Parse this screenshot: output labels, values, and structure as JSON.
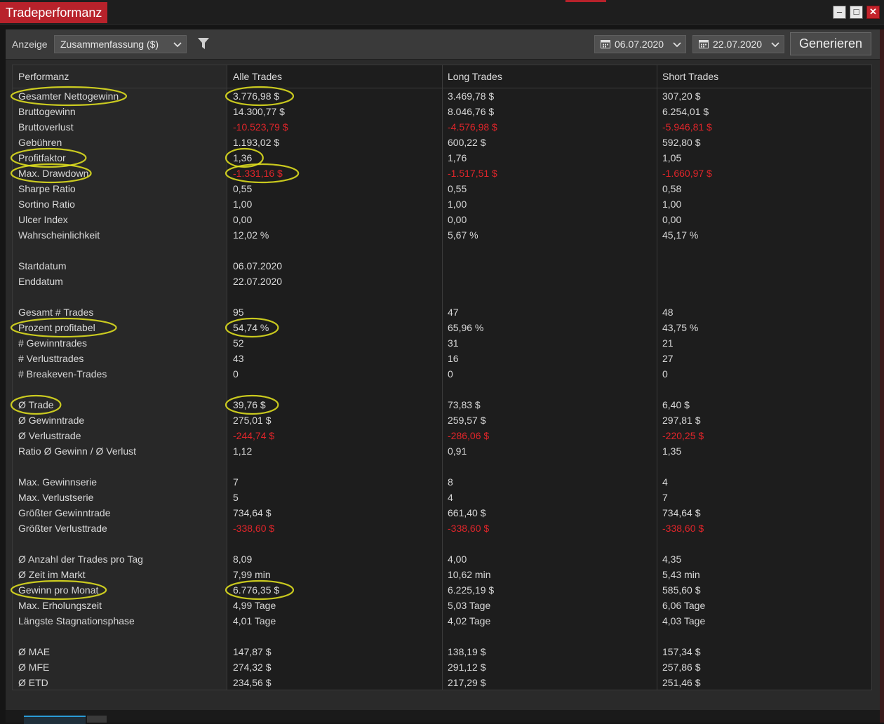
{
  "window": {
    "title": "Tradeperformanz",
    "controls": [
      "minimize-icon",
      "maximize-icon",
      "close-icon"
    ]
  },
  "toolbar": {
    "display_label": "Anzeige",
    "display_value": "Zusammenfassung ($)",
    "date_from": "06.07.2020",
    "date_to": "22.07.2020",
    "generate_label": "Generieren"
  },
  "colors": {
    "accent": "#b8222b",
    "negative": "#e0252a",
    "highlight": "#e6e61e"
  },
  "table": {
    "headers": [
      "Performanz",
      "Alle Trades",
      "Long Trades",
      "Short Trades"
    ],
    "rows": [
      {
        "label": "Gesamter Nettogewinn",
        "all": "3.776,98 $",
        "long": "3.469,78 $",
        "short": "307,20 $",
        "neg": false,
        "hl": true
      },
      {
        "label": "Bruttogewinn",
        "all": "14.300,77 $",
        "long": "8.046,76 $",
        "short": "6.254,01 $",
        "neg": false
      },
      {
        "label": "Bruttoverlust",
        "all": "-10.523,79 $",
        "long": "-4.576,98 $",
        "short": "-5.946,81 $",
        "neg": true
      },
      {
        "label": "Gebühren",
        "all": "1.193,02 $",
        "long": "600,22 $",
        "short": "592,80 $",
        "neg": false
      },
      {
        "label": "Profitfaktor",
        "all": "1,36",
        "long": "1,76",
        "short": "1,05",
        "neg": false,
        "hl": true
      },
      {
        "label": "Max. Drawdown",
        "all": "-1.331,16 $",
        "long": "-1.517,51 $",
        "short": "-1.660,97 $",
        "neg": true,
        "hl": true
      },
      {
        "label": "Sharpe Ratio",
        "all": "0,55",
        "long": "0,55",
        "short": "0,58",
        "neg": false
      },
      {
        "label": "Sortino Ratio",
        "all": "1,00",
        "long": "1,00",
        "short": "1,00",
        "neg": false
      },
      {
        "label": "Ulcer Index",
        "all": "0,00",
        "long": "0,00",
        "short": "0,00",
        "neg": false
      },
      {
        "label": "Wahrscheinlichkeit",
        "all": "12,02 %",
        "long": "5,67 %",
        "short": "45,17 %",
        "neg": false
      },
      {
        "spacer": true
      },
      {
        "label": "Startdatum",
        "all": "06.07.2020",
        "long": "",
        "short": "",
        "neg": false
      },
      {
        "label": "Enddatum",
        "all": "22.07.2020",
        "long": "",
        "short": "",
        "neg": false
      },
      {
        "spacer": true
      },
      {
        "label": "Gesamt # Trades",
        "all": "95",
        "long": "47",
        "short": "48",
        "neg": false
      },
      {
        "label": "Prozent profitabel",
        "all": "54,74 %",
        "long": "65,96 %",
        "short": "43,75 %",
        "neg": false,
        "hl": true
      },
      {
        "label": "# Gewinntrades",
        "all": "52",
        "long": "31",
        "short": "21",
        "neg": false
      },
      {
        "label": "# Verlusttrades",
        "all": "43",
        "long": "16",
        "short": "27",
        "neg": false
      },
      {
        "label": "# Breakeven-Trades",
        "all": "0",
        "long": "0",
        "short": "0",
        "neg": false
      },
      {
        "spacer": true
      },
      {
        "label": "Ø Trade",
        "all": "39,76 $",
        "long": "73,83 $",
        "short": "6,40 $",
        "neg": false,
        "hl": true
      },
      {
        "label": "Ø Gewinntrade",
        "all": "275,01 $",
        "long": "259,57 $",
        "short": "297,81 $",
        "neg": false
      },
      {
        "label": "Ø Verlusttrade",
        "all": "-244,74 $",
        "long": "-286,06 $",
        "short": "-220,25 $",
        "neg": true
      },
      {
        "label": "Ratio Ø Gewinn / Ø Verlust",
        "all": "1,12",
        "long": "0,91",
        "short": "1,35",
        "neg": false
      },
      {
        "spacer": true
      },
      {
        "label": "Max. Gewinnserie",
        "all": "7",
        "long": "8",
        "short": "4",
        "neg": false
      },
      {
        "label": "Max. Verlustserie",
        "all": "5",
        "long": "4",
        "short": "7",
        "neg": false
      },
      {
        "label": "Größter Gewinntrade",
        "all": "734,64 $",
        "long": "661,40 $",
        "short": "734,64 $",
        "neg": false
      },
      {
        "label": "Größter Verlusttrade",
        "all": "-338,60 $",
        "long": "-338,60 $",
        "short": "-338,60 $",
        "neg": true
      },
      {
        "spacer": true
      },
      {
        "label": "Ø Anzahl der Trades pro Tag",
        "all": "8,09",
        "long": "4,00",
        "short": "4,35",
        "neg": false
      },
      {
        "label": "Ø Zeit im Markt",
        "all": "7,99 min",
        "long": "10,62 min",
        "short": "5,43 min",
        "neg": false
      },
      {
        "label": "Gewinn pro Monat",
        "all": "6.776,35 $",
        "long": "6.225,19 $",
        "short": "585,60 $",
        "neg": false,
        "hl": true
      },
      {
        "label": "Max. Erholungszeit",
        "all": "4,99 Tage",
        "long": "5,03 Tage",
        "short": "6,06 Tage",
        "neg": false
      },
      {
        "label": "Längste Stagnationsphase",
        "all": "4,01 Tage",
        "long": "4,02 Tage",
        "short": "4,03 Tage",
        "neg": false
      },
      {
        "spacer": true
      },
      {
        "label": "Ø MAE",
        "all": "147,87 $",
        "long": "138,19 $",
        "short": "157,34 $",
        "neg": false
      },
      {
        "label": "Ø MFE",
        "all": "274,32 $",
        "long": "291,12 $",
        "short": "257,86 $",
        "neg": false
      },
      {
        "label": "Ø ETD",
        "all": "234,56 $",
        "long": "217,29 $",
        "short": "251,46 $",
        "neg": false
      }
    ]
  }
}
